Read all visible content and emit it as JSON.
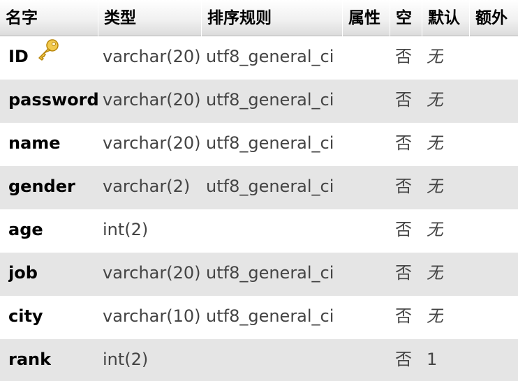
{
  "columns": [
    {
      "label": "名字"
    },
    {
      "label": "类型"
    },
    {
      "label": "排序规则"
    },
    {
      "label": "属性"
    },
    {
      "label": "空"
    },
    {
      "label": "默认"
    },
    {
      "label": "额外"
    }
  ],
  "rows": [
    {
      "name": "ID",
      "type": "varchar(20)",
      "collation": "utf8_general_ci",
      "null": "否",
      "default": "无",
      "primary_key": true
    },
    {
      "name": "password",
      "type": "varchar(20)",
      "collation": "utf8_general_ci",
      "null": "否",
      "default": "无"
    },
    {
      "name": "name",
      "type": "varchar(20)",
      "collation": "utf8_general_ci",
      "null": "否",
      "default": "无"
    },
    {
      "name": "gender",
      "type": "varchar(2)",
      "collation": "utf8_general_ci",
      "null": "否",
      "default": "无"
    },
    {
      "name": "age",
      "type": "int(2)",
      "collation": "",
      "null": "否",
      "default": "无"
    },
    {
      "name": "job",
      "type": "varchar(20)",
      "collation": "utf8_general_ci",
      "null": "否",
      "default": "无"
    },
    {
      "name": "city",
      "type": "varchar(10)",
      "collation": "utf8_general_ci",
      "null": "否",
      "default": "无"
    },
    {
      "name": "rank",
      "type": "int(2)",
      "collation": "",
      "null": "否",
      "default": "1"
    }
  ],
  "icons": {
    "primary_key": "key-icon"
  },
  "colors": {
    "header_bg": "#e8e8e8",
    "row_alt": "#e5e5e5",
    "text": "#444444",
    "key": "#e8b923"
  }
}
